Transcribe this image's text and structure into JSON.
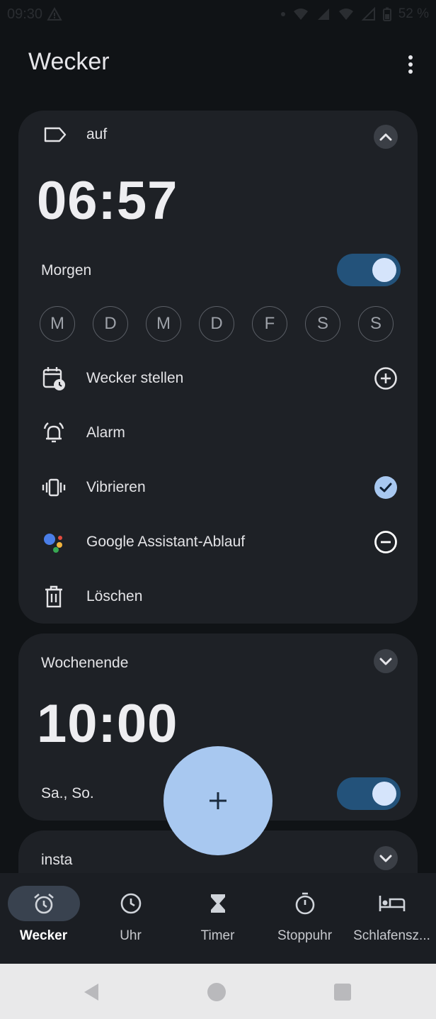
{
  "status_bar": {
    "time": "09:30",
    "battery": "52 %"
  },
  "app": {
    "title": "Wecker"
  },
  "alarms": [
    {
      "label": "auf",
      "time": "06:57",
      "name": "Morgen",
      "enabled": true,
      "expanded": true,
      "days": [
        "M",
        "D",
        "M",
        "D",
        "F",
        "S",
        "S"
      ],
      "options": {
        "schedule": "Wecker stellen",
        "sound": "Alarm",
        "vibrate": "Vibrieren",
        "assistant": "Google Assistant-Ablauf",
        "delete": "Löschen"
      }
    },
    {
      "label": "Wochenende",
      "time": "10:00",
      "days_summary": "Sa., So.",
      "enabled": true,
      "expanded": false
    },
    {
      "label": "insta",
      "expanded": false
    }
  ],
  "nav": [
    {
      "label": "Wecker",
      "icon": "alarm-icon",
      "active": true
    },
    {
      "label": "Uhr",
      "icon": "clock-icon"
    },
    {
      "label": "Timer",
      "icon": "hourglass-icon"
    },
    {
      "label": "Stoppuhr",
      "icon": "stopwatch-icon"
    },
    {
      "label": "Schlafensz...",
      "icon": "bed-icon"
    }
  ],
  "colors": {
    "background": "#101316",
    "card": "#1e2126",
    "accent": "#a8c8f0",
    "toggle_track": "#23527a"
  }
}
